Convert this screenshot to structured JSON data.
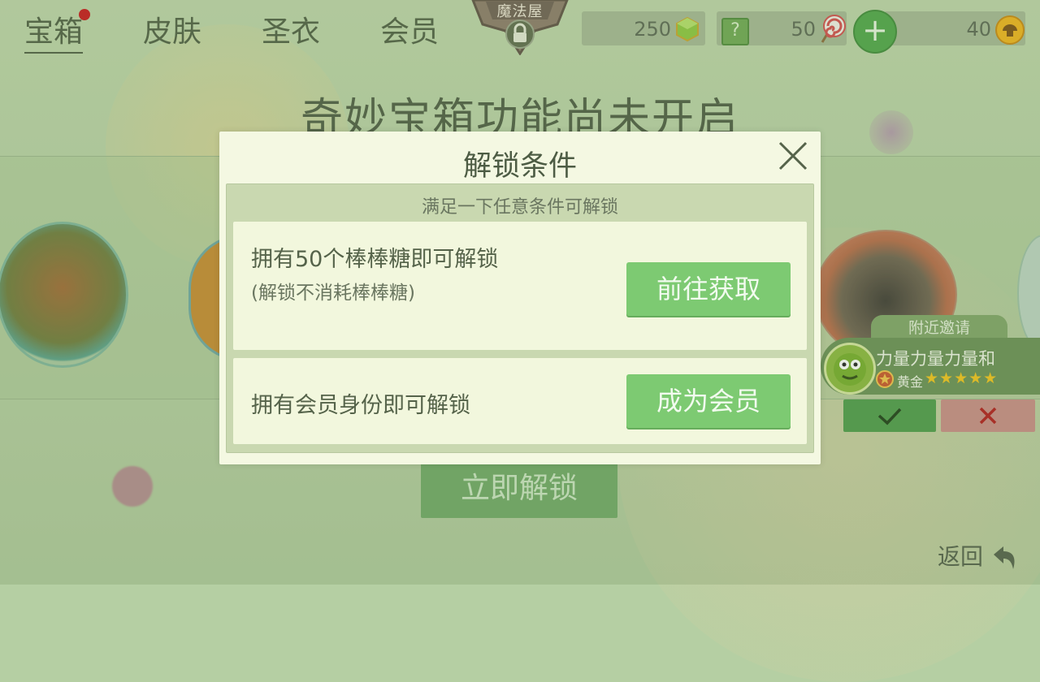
{
  "tabs": [
    {
      "label": "宝箱",
      "active": true,
      "badge": true
    },
    {
      "label": "皮肤"
    },
    {
      "label": "圣衣"
    },
    {
      "label": "会员"
    }
  ],
  "emblem": {
    "label": "魔法屋",
    "icon": "lock-icon"
  },
  "currency": {
    "gems": "250",
    "lollipop": "50",
    "coins": "40",
    "mystery_icon": "?"
  },
  "page_title": "奇妙宝箱功能尚未开启",
  "unlock_now": "立即解锁",
  "back_label": "返回",
  "nearby_invite": {
    "header": "附近邀请",
    "player_name": "力量力量力量和",
    "rank": "黄金",
    "stars": 5
  },
  "modal": {
    "title": "解锁条件",
    "subtitle": "满足一下任意条件可解锁",
    "conditions": [
      {
        "text": "拥有50个棒棒糖即可解锁",
        "note": "(解锁不消耗棒棒糖)",
        "button": "前往获取"
      },
      {
        "text": "拥有会员身份即可解锁",
        "button": "成为会员"
      }
    ]
  },
  "colors": {
    "accent_green": "#7dca72",
    "red_badge": "#c9151a",
    "decline": "#c98c86"
  }
}
